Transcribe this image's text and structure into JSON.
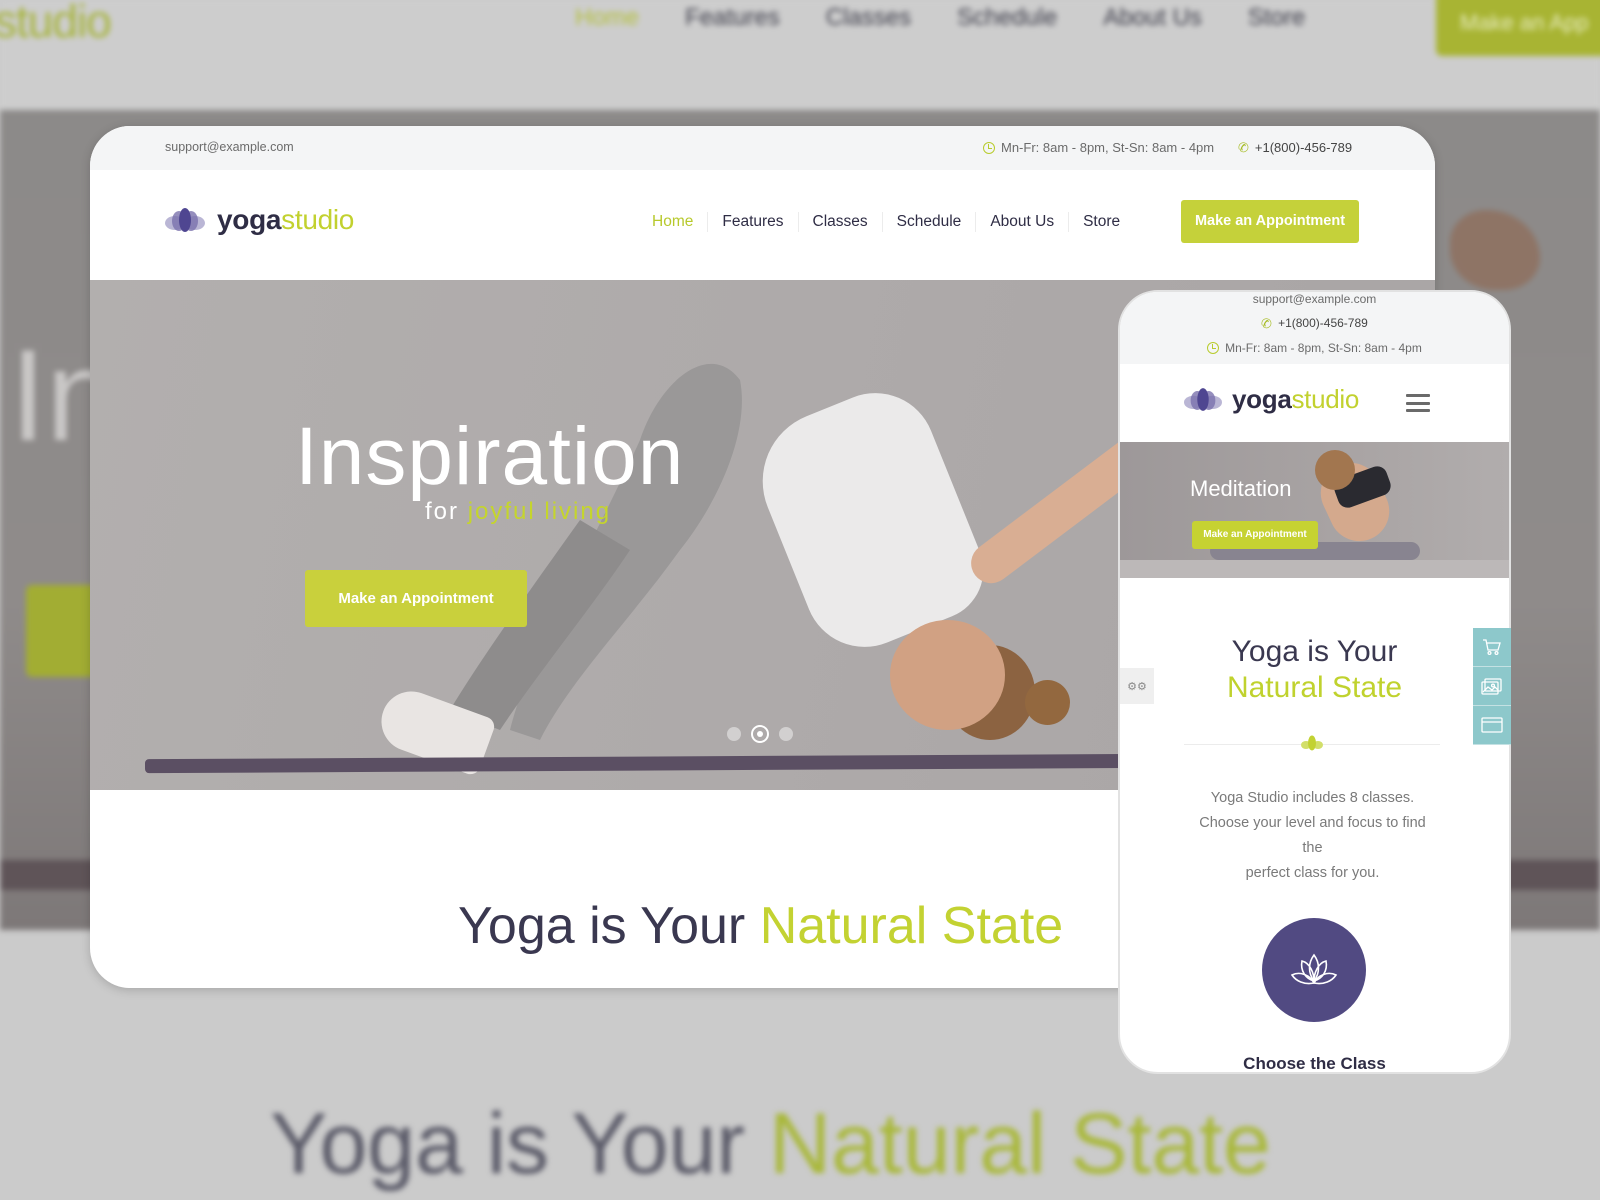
{
  "background": {
    "logo_fragment": "studio",
    "nav": [
      "Home",
      "Features",
      "Classes",
      "Schedule",
      "About Us",
      "Store"
    ],
    "cta": "Make an App",
    "hero_fragment": "In",
    "title_main": "Yoga is Your ",
    "title_accent": "Natural State"
  },
  "desktop": {
    "topbar": {
      "email": "support@example.com",
      "hours": "Mn-Fr: 8am - 8pm, St-Sn: 8am - 4pm",
      "phone": "+1(800)-456-789"
    },
    "logo": {
      "primary": "yoga",
      "accent": "studio"
    },
    "nav": [
      {
        "label": "Home",
        "active": true
      },
      {
        "label": "Features"
      },
      {
        "label": "Classes"
      },
      {
        "label": "Schedule"
      },
      {
        "label": "About Us"
      },
      {
        "label": "Store"
      }
    ],
    "appointment_button": "Make an Appointment",
    "hero": {
      "title": "Inspiration",
      "subtitle_prefix": "for ",
      "subtitle_accent": "joyful living",
      "button": "Make an Appointment",
      "slides": 3,
      "active_slide": 2
    },
    "section": {
      "title_main": "Yoga is Your ",
      "title_accent": "Natural State"
    }
  },
  "mobile": {
    "topbar": {
      "email": "support@example.com",
      "phone": "+1(800)-456-789",
      "hours": "Mn-Fr: 8am - 8pm, St-Sn: 8am - 4pm"
    },
    "logo": {
      "primary": "yoga",
      "accent": "studio"
    },
    "hero": {
      "title": "Meditation",
      "button": "Make an Appointment"
    },
    "section": {
      "title_main": "Yoga is Your",
      "title_accent": "Natural State",
      "description_lines": [
        "Yoga Studio includes 8 classes.",
        "Choose your level and focus to find",
        "the",
        "perfect class for you."
      ]
    },
    "cta_title": "Choose the Class",
    "side_icons": [
      "cart-icon",
      "image-gallery-icon",
      "browser-window-icon"
    ]
  },
  "colors": {
    "accent": "#c5d13a",
    "brand_dark": "#2f2d45",
    "purple": "#514a82",
    "teal_side": "#8dc8cb"
  }
}
